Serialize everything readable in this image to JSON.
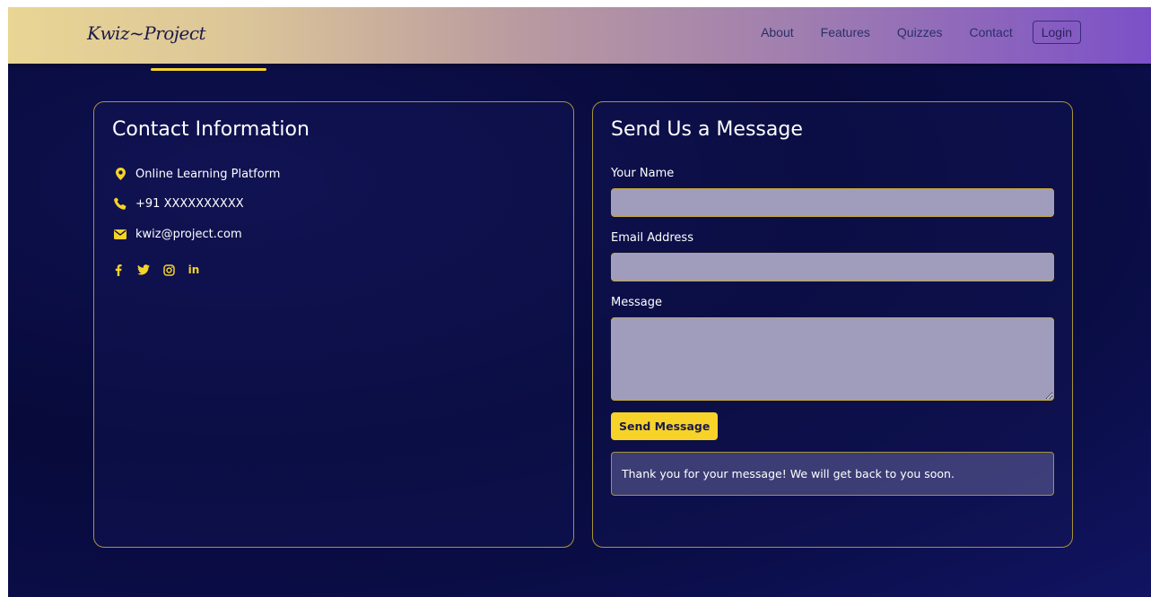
{
  "brand": {
    "name": "Kwiz~Project"
  },
  "nav": {
    "links": [
      {
        "label": "About"
      },
      {
        "label": "Features"
      },
      {
        "label": "Quizzes"
      },
      {
        "label": "Contact"
      }
    ],
    "login_label": "Login"
  },
  "colors": {
    "accent": "#f5d328",
    "background": "#070a3a",
    "input_bg": "#a09dbc",
    "border": "#a8943a"
  },
  "contact_info": {
    "title": "Contact Information",
    "location": {
      "icon": "map-marker-icon",
      "text": "Online Learning Platform"
    },
    "phone": {
      "icon": "phone-icon",
      "text": "+91 XXXXXXXXXX"
    },
    "email": {
      "icon": "envelope-icon",
      "text": "kwiz@project.com"
    },
    "socials": [
      {
        "icon": "facebook-icon",
        "glyph": "f"
      },
      {
        "icon": "twitter-icon",
        "glyph": ""
      },
      {
        "icon": "instagram-icon",
        "glyph": ""
      },
      {
        "icon": "linkedin-icon",
        "glyph": "in"
      }
    ]
  },
  "message_form": {
    "title": "Send Us a Message",
    "name_label": "Your Name",
    "name_value": "",
    "email_label": "Email Address",
    "email_value": "",
    "message_label": "Message",
    "message_value": "",
    "submit_label": "Send Message",
    "success_text": "Thank you for your message! We will get back to you soon."
  }
}
